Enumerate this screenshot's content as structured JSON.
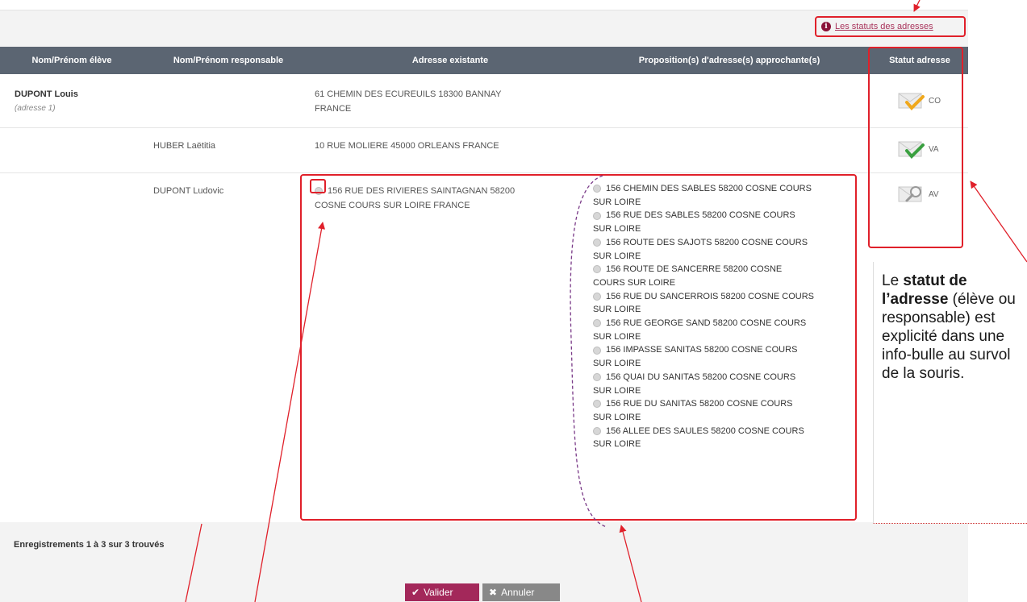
{
  "top": {
    "statut_link_label": "Les statuts des adresses"
  },
  "table": {
    "headers": {
      "eleve": "Nom/Prénom élève",
      "responsable": "Nom/Prénom responsable",
      "existante": "Adresse existante",
      "propositions": "Proposition(s) d'adresse(s) approchante(s)",
      "statut": "Statut adresse"
    },
    "rows": [
      {
        "eleve": "DUPONT Louis",
        "eleve_sub": "(adresse 1)",
        "responsable": "",
        "adresse_line1": "61 CHEMIN DES ECUREUILS 18300 BANNAY",
        "adresse_line2": "FRANCE",
        "statut": "CO"
      },
      {
        "eleve": "",
        "responsable": "HUBER Laëtitia",
        "adresse_line1": "10 RUE MOLIERE 45000 ORLEANS FRANCE",
        "statut": "VA"
      },
      {
        "eleve": "",
        "responsable": "DUPONT Ludovic",
        "adresse_line1": "156 RUE DES RIVIERES SAINTAGNAN 58200",
        "adresse_line2": "COSNE COURS SUR LOIRE FRANCE",
        "statut": "AV",
        "suggestions": [
          {
            "l1": "156 CHEMIN DES SABLES 58200 COSNE COURS",
            "l2": "SUR LOIRE"
          },
          {
            "l1": "156 RUE DES SABLES 58200 COSNE COURS",
            "l2": "SUR LOIRE"
          },
          {
            "l1": "156 ROUTE DES SAJOTS 58200 COSNE COURS",
            "l2": "SUR LOIRE"
          },
          {
            "l1": "156 ROUTE DE SANCERRE 58200 COSNE",
            "l2": "COURS SUR LOIRE"
          },
          {
            "l1": "156 RUE DU SANCERROIS 58200 COSNE COURS",
            "l2": "SUR LOIRE"
          },
          {
            "l1": "156 RUE GEORGE SAND 58200 COSNE COURS",
            "l2": "SUR LOIRE"
          },
          {
            "l1": "156 IMPASSE SANITAS 58200 COSNE COURS",
            "l2": "SUR LOIRE"
          },
          {
            "l1": "156 QUAI DU SANITAS 58200 COSNE COURS",
            "l2": "SUR LOIRE"
          },
          {
            "l1": "156 RUE DU SANITAS 58200 COSNE COURS",
            "l2": "SUR LOIRE"
          },
          {
            "l1": "156 ALLEE DES SAULES 58200 COSNE COURS",
            "l2": "SUR LOIRE"
          }
        ]
      }
    ]
  },
  "footer": {
    "count": "Enregistrements 1 à 3 sur 3 trouvés",
    "valider": "Valider",
    "annuler": "Annuler"
  },
  "note": {
    "t1": "Le ",
    "t2": "statut de l’adresse",
    "t3": " (élève ou responsable) est explicité dans une info-bulle au survol de la souris."
  },
  "colors": {
    "header_bg": "#5b6572",
    "annotation_red": "#e0202a",
    "valider_bg": "#a3285a",
    "annuler_bg": "#888888",
    "check_orange": "#f0a81c",
    "check_green": "#3aa040",
    "dash_purple": "#7a3a88"
  }
}
